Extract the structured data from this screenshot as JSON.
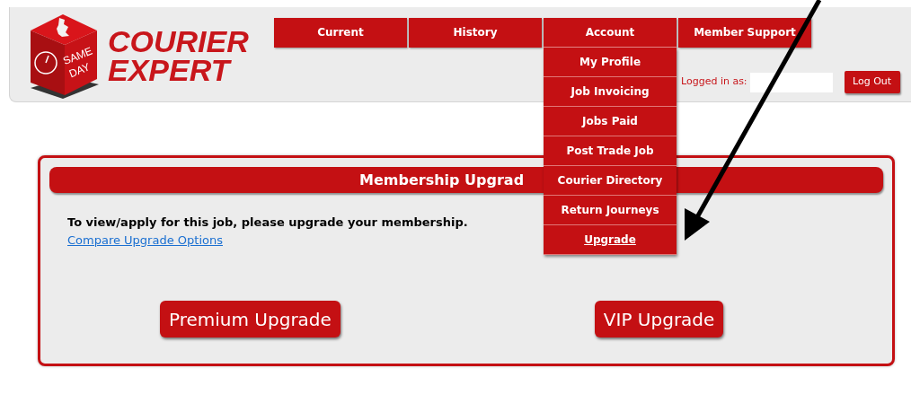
{
  "logo": {
    "badge": [
      "SAME",
      "DAY"
    ],
    "name": [
      "COURIER",
      "EXPERT"
    ]
  },
  "nav": [
    {
      "label": "Current",
      "expanded": false
    },
    {
      "label": "History",
      "expanded": false
    },
    {
      "label": "Account",
      "expanded": true,
      "menu": [
        {
          "label": "My Profile",
          "selected": false
        },
        {
          "label": "Job Invoicing",
          "selected": false
        },
        {
          "label": "Jobs Paid",
          "selected": false
        },
        {
          "label": "Post Trade Job",
          "selected": false
        },
        {
          "label": "Courier Directory",
          "selected": false
        },
        {
          "label": "Return Journeys",
          "selected": false
        },
        {
          "label": "Upgrade",
          "selected": true
        }
      ]
    },
    {
      "label": "Member Support",
      "expanded": false
    }
  ],
  "login": {
    "label": "Logged in as:",
    "logout": "Log Out"
  },
  "panel": {
    "title": "Membership Upgrad",
    "message": "To view/apply for this job, please upgrade your membership.",
    "link": "Compare Upgrade Options",
    "buttons": [
      "Premium Upgrade",
      "VIP Upgrade"
    ]
  }
}
